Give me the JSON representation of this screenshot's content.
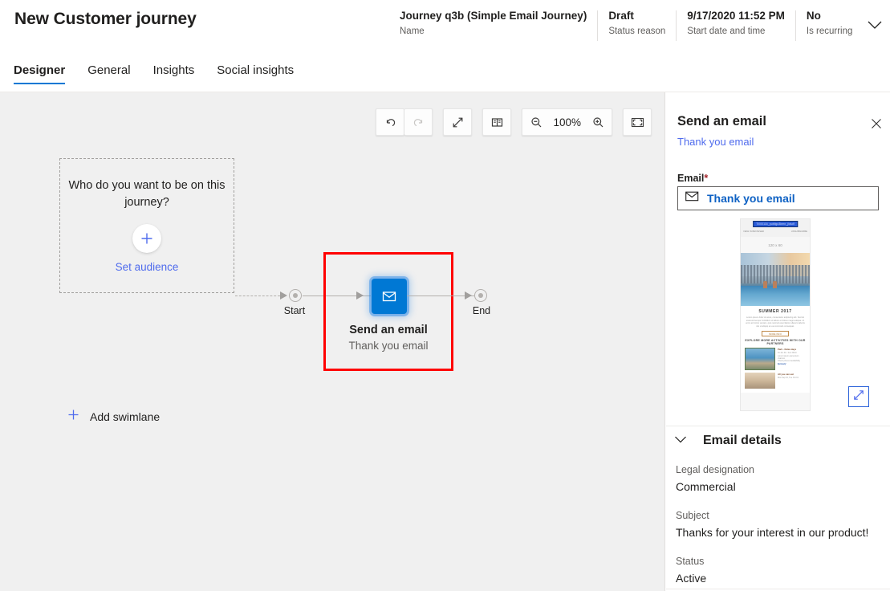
{
  "header": {
    "title": "New Customer journey",
    "fields": [
      {
        "value": "Journey q3b (Simple Email Journey)",
        "label": "Name"
      },
      {
        "value": "Draft",
        "label": "Status reason"
      },
      {
        "value": "9/17/2020 11:52 PM",
        "label": "Start date and time"
      },
      {
        "value": "No",
        "label": "Is recurring"
      }
    ],
    "chevron_icon": "chevron-down-icon"
  },
  "tabs": [
    {
      "label": "Designer",
      "active": true
    },
    {
      "label": "General",
      "active": false
    },
    {
      "label": "Insights",
      "active": false
    },
    {
      "label": "Social insights",
      "active": false
    }
  ],
  "toolbar": {
    "undo": "undo-icon",
    "redo": "redo-icon",
    "expand": "expand-diagonal-icon",
    "map": "map-icon",
    "zoom_out": "zoom-out-icon",
    "zoom_level": "100%",
    "zoom_in": "zoom-in-icon",
    "fit_to_screen": "fit-to-screen-icon"
  },
  "canvas": {
    "swimlane": {
      "question": "Who do you want to be on this journey?",
      "add_icon": "plus-icon",
      "set_audience_label": "Set audience"
    },
    "start_label": "Start",
    "end_label": "End",
    "tile": {
      "icon": "envelope-icon",
      "title": "Send an email",
      "subtitle": "Thank you email",
      "selection_color": "#ff0000",
      "tile_color": "#0078d4"
    },
    "add_swimlane": {
      "icon": "plus-icon",
      "label": "Add swimlane"
    }
  },
  "panel": {
    "title": "Send an email",
    "subtitle": "Thank you email",
    "close_icon": "close-icon",
    "email_field": {
      "label": "Email",
      "required_marker": "*",
      "icon": "envelope-icon",
      "value": "Thank you email"
    },
    "preview": {
      "header_link": "Ti000116_publigo3bmn_jldsdf",
      "tiny_left": "VIEW IN BROWSER",
      "tiny_right": "UNSUBSCRIBE",
      "logo_placeholder": "120 x 60",
      "heading": "SUMMER 2017",
      "body": "Lorem ipsum dolor sit amet, consectetur adipiscing elit. Sed do eiusmod tempor incididunt ut labore et dolore magna aliqua. Ut enim ad minim veniam, quis nostrud exercitation ullamco laboris nisi ut aliquip ex ea commodo consequat.",
      "cta": "MORE INFO",
      "partners_heading": "EXPLORE MORE ACTIVITIES WITH OUR PARTNERS",
      "item1_title": "Park - Relax days",
      "item1_line1": "01 Jun 30 - Sun 30/10",
      "item1_line2": "Lorem ipsum elementum vivamus",
      "item1_line3": "Check prices & availability",
      "item1_price": "€price/q'",
      "item2_title": "All you can eat",
      "item2_line1": "Mon Sep 01, Tue Oct 01",
      "expand_icon": "expand-diagonal-icon"
    },
    "details": {
      "chevron_icon": "chevron-down-icon",
      "section_title": "Email details",
      "rows": [
        {
          "key": "Legal designation",
          "value": "Commercial"
        },
        {
          "key": "Subject",
          "value": "Thanks for your interest in our product!"
        },
        {
          "key": "Status",
          "value": "Active"
        }
      ]
    }
  },
  "colors": {
    "accent": "#0078d4",
    "link": "#4f6bed",
    "selection": "#ff0000",
    "canvas_bg": "#f0f0f0"
  }
}
